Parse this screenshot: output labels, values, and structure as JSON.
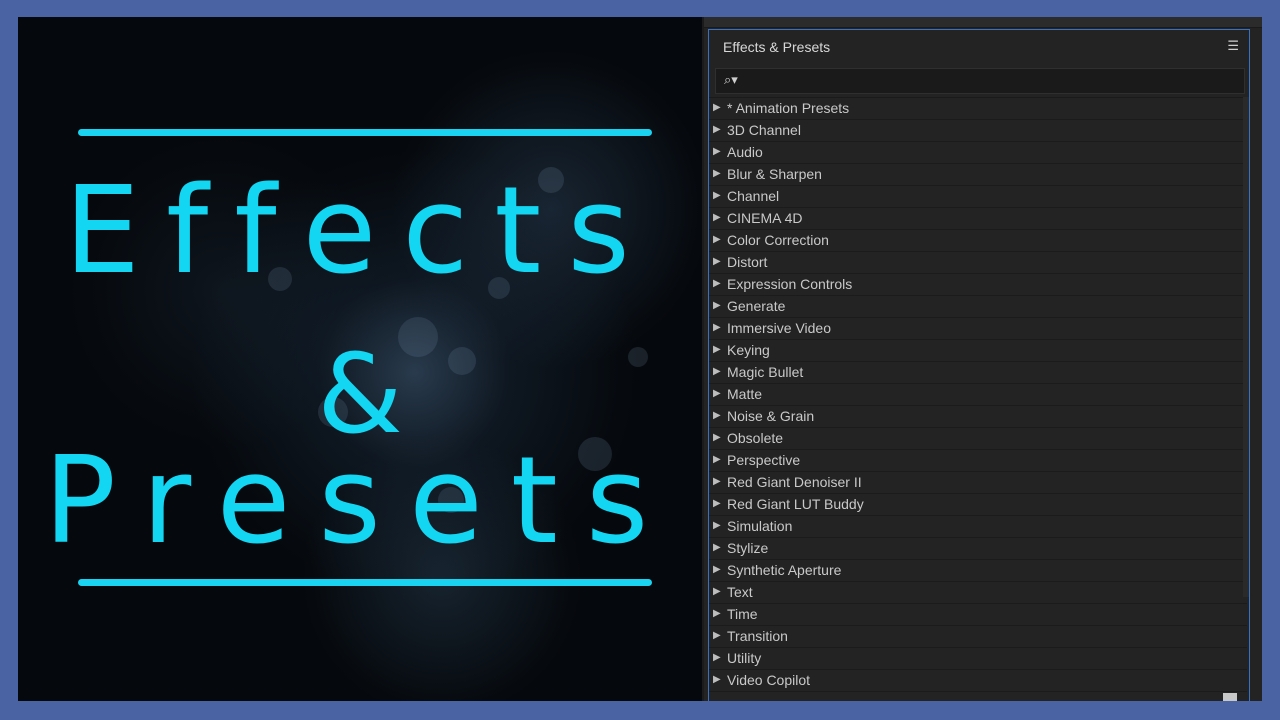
{
  "graphic": {
    "line1": "Effects",
    "line2": "&",
    "line3": "Presets",
    "accent_color": "#12d6f2",
    "border_color": "#4a63a3"
  },
  "panel": {
    "title": "Effects & Presets",
    "menu_icon": "hamburger-menu-icon",
    "search": {
      "icon": "search-icon",
      "value": "",
      "placeholder": ""
    },
    "items": [
      "* Animation Presets",
      "3D Channel",
      "Audio",
      "Blur & Sharpen",
      "Channel",
      "CINEMA 4D",
      "Color Correction",
      "Distort",
      "Expression Controls",
      "Generate",
      "Immersive Video",
      "Keying",
      "Magic Bullet",
      "Matte",
      "Noise & Grain",
      "Obsolete",
      "Perspective",
      "Red Giant Denoiser II",
      "Red Giant LUT Buddy",
      "Simulation",
      "Stylize",
      "Synthetic Aperture",
      "Text",
      "Time",
      "Transition",
      "Utility",
      "Video Copilot"
    ],
    "accent_border": "#3a6fc2"
  }
}
